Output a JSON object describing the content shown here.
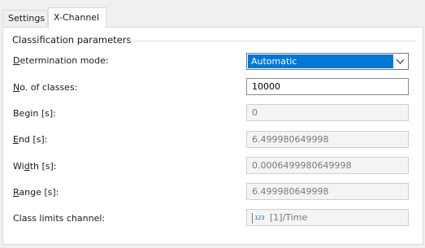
{
  "tabs": [
    {
      "label": "Settings",
      "active": false
    },
    {
      "label": "X-Channel",
      "active": true
    }
  ],
  "group": {
    "title": "Classification parameters"
  },
  "fields": {
    "determination_mode": {
      "label_access": "D",
      "label_rest": "etermination mode:",
      "value": "Automatic"
    },
    "no_of_classes": {
      "label_access": "N",
      "label_rest": "o. of classes:",
      "value": "10000"
    },
    "begin": {
      "label": "Begin [s]:",
      "value": "0"
    },
    "end": {
      "label_access": "E",
      "label_rest": "nd [s]:",
      "value": "6.499980649998"
    },
    "width": {
      "label_pre": "Wi",
      "label_access": "d",
      "label_rest": "th [s]:",
      "value": "0.0006499980649998"
    },
    "range": {
      "label_access": "R",
      "label_rest": "ange [s]:",
      "value": "6.499980649998"
    },
    "class_limits_channel": {
      "label": "Class limits channel:",
      "value": "[1]/Time",
      "icon_text": "123",
      "icon": "numeric-channel-icon"
    }
  },
  "colors": {
    "selection": "#0078d7",
    "panel": "#ffffff",
    "background": "#f0f0f0"
  }
}
